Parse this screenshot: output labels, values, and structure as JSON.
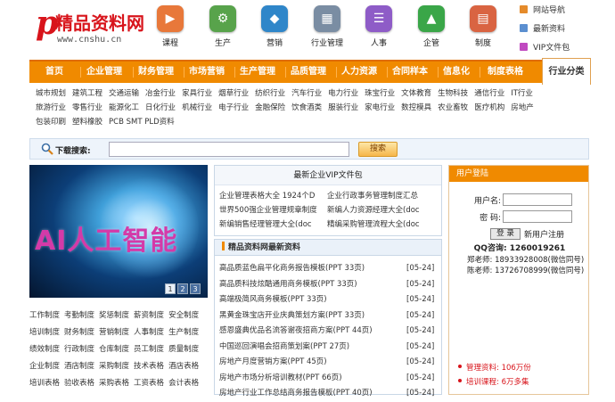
{
  "logo": {
    "mark": "p",
    "title": "精品资料网",
    "url": "www.cnshu.cn"
  },
  "categories": [
    {
      "label": "课程",
      "color": "#e8783a"
    },
    {
      "label": "生产",
      "color": "#58a34b"
    },
    {
      "label": "营销",
      "color": "#2f86c9"
    },
    {
      "label": "行业管理",
      "color": "#7a8da3"
    },
    {
      "label": "人事",
      "color": "#8e5cc7"
    },
    {
      "label": "企管",
      "color": "#3aa648"
    },
    {
      "label": "制度",
      "color": "#d96442"
    }
  ],
  "toplinks": [
    {
      "label": "网站导航",
      "color": "#e58b2b"
    },
    {
      "label": "最新资料",
      "color": "#5b8fd0"
    },
    {
      "label": "VIP文件包",
      "color": "#c04ac0"
    }
  ],
  "nav": {
    "items": [
      "首页",
      "企业管理",
      "财务管理",
      "市场营销",
      "生产管理",
      "品质管理",
      "人力资源",
      "合同样本",
      "信息化",
      "制度表格"
    ],
    "active_tab": "行业分类"
  },
  "subcats": [
    [
      "城市规划",
      "建筑工程",
      "交通运输",
      "冶金行业",
      "家具行业",
      "烟草行业",
      "纺织行业",
      "汽车行业",
      "电力行业",
      "珠宝行业",
      "文体教育",
      "生物科技",
      "通信行业",
      "IT行业"
    ],
    [
      "旅游行业",
      "零售行业",
      "能源化工",
      "日化行业",
      "机械行业",
      "电子行业",
      "金融保险",
      "饮食酒类",
      "服装行业",
      "家电行业",
      "数控模具",
      "农业畜牧",
      "医疗机构",
      "房地产"
    ],
    [
      "包装印刷",
      "塑料橡胶",
      "PCB SMT PLD资料"
    ]
  ],
  "search": {
    "label": "下载搜索:",
    "value": "",
    "button": "搜索"
  },
  "banner": {
    "text": "AI人工智能",
    "pages": [
      "1",
      "2",
      "3"
    ]
  },
  "leftlinks": [
    [
      "工作制度",
      "考勤制度",
      "奖惩制度",
      "薪资制度",
      "安全制度"
    ],
    [
      "培训制度",
      "财务制度",
      "营销制度",
      "人事制度",
      "生产制度"
    ],
    [
      "绩效制度",
      "行政制度",
      "仓库制度",
      "员工制度",
      "质量制度"
    ],
    [
      "企业制度",
      "酒店制度",
      "采购制度",
      "技术表格",
      "酒店表格"
    ],
    [
      "培训表格",
      "验收表格",
      "采购表格",
      "工资表格",
      "会计表格"
    ]
  ],
  "vip": {
    "title": "最新企业VIP文件包",
    "items": [
      "企业管理表格大全 1924个D",
      "企业行政事务管理制度汇总",
      "世界500强企业管理规章制度",
      "新编人力资源经理大全(doc",
      "新编销售经理管理大全(doc",
      "精编采购管理流程大全(doc"
    ]
  },
  "news": {
    "title": "精品资料网最新资料",
    "items": [
      {
        "title": "高品质蓝色扁平化商务报告模板(PPT 33页)",
        "date": "[05-24]"
      },
      {
        "title": "高品质科技炫酷通用商务模板(PPT 33页)",
        "date": "[05-24]"
      },
      {
        "title": "高端极简风商务模板(PPT 33页)",
        "date": "[05-24]"
      },
      {
        "title": "黑黄金珠宝店开业庆典策划方案(PPT 33页)",
        "date": "[05-24]"
      },
      {
        "title": "感恩盛典优品名流答谢夜招商方案(PPT 44页)",
        "date": "[05-24]"
      },
      {
        "title": "中国巡回演唱会招商策划案(PPT 27页)",
        "date": "[05-24]"
      },
      {
        "title": "房地产月度营销方案(PPT 45页)",
        "date": "[05-24]"
      },
      {
        "title": "房地产市场分析培训教材(PPT 66页)",
        "date": "[05-24]"
      },
      {
        "title": "房地产行业工作总结商务报告模板(PPT 40页)",
        "date": "[05-24]"
      }
    ]
  },
  "login": {
    "title": "用户登陆",
    "username_label": "用户名:",
    "password_label": "密  码:",
    "login_button": "登 录",
    "register": "新用户注册",
    "qq": "QQ咨询: 1260019261",
    "contacts": [
      "郑老师: 18933928008(微信同号)",
      "陈老师: 13726708999(微信同号)"
    ],
    "stats": [
      "管理资料: 106万份",
      "培训课程: 6万多集"
    ]
  }
}
